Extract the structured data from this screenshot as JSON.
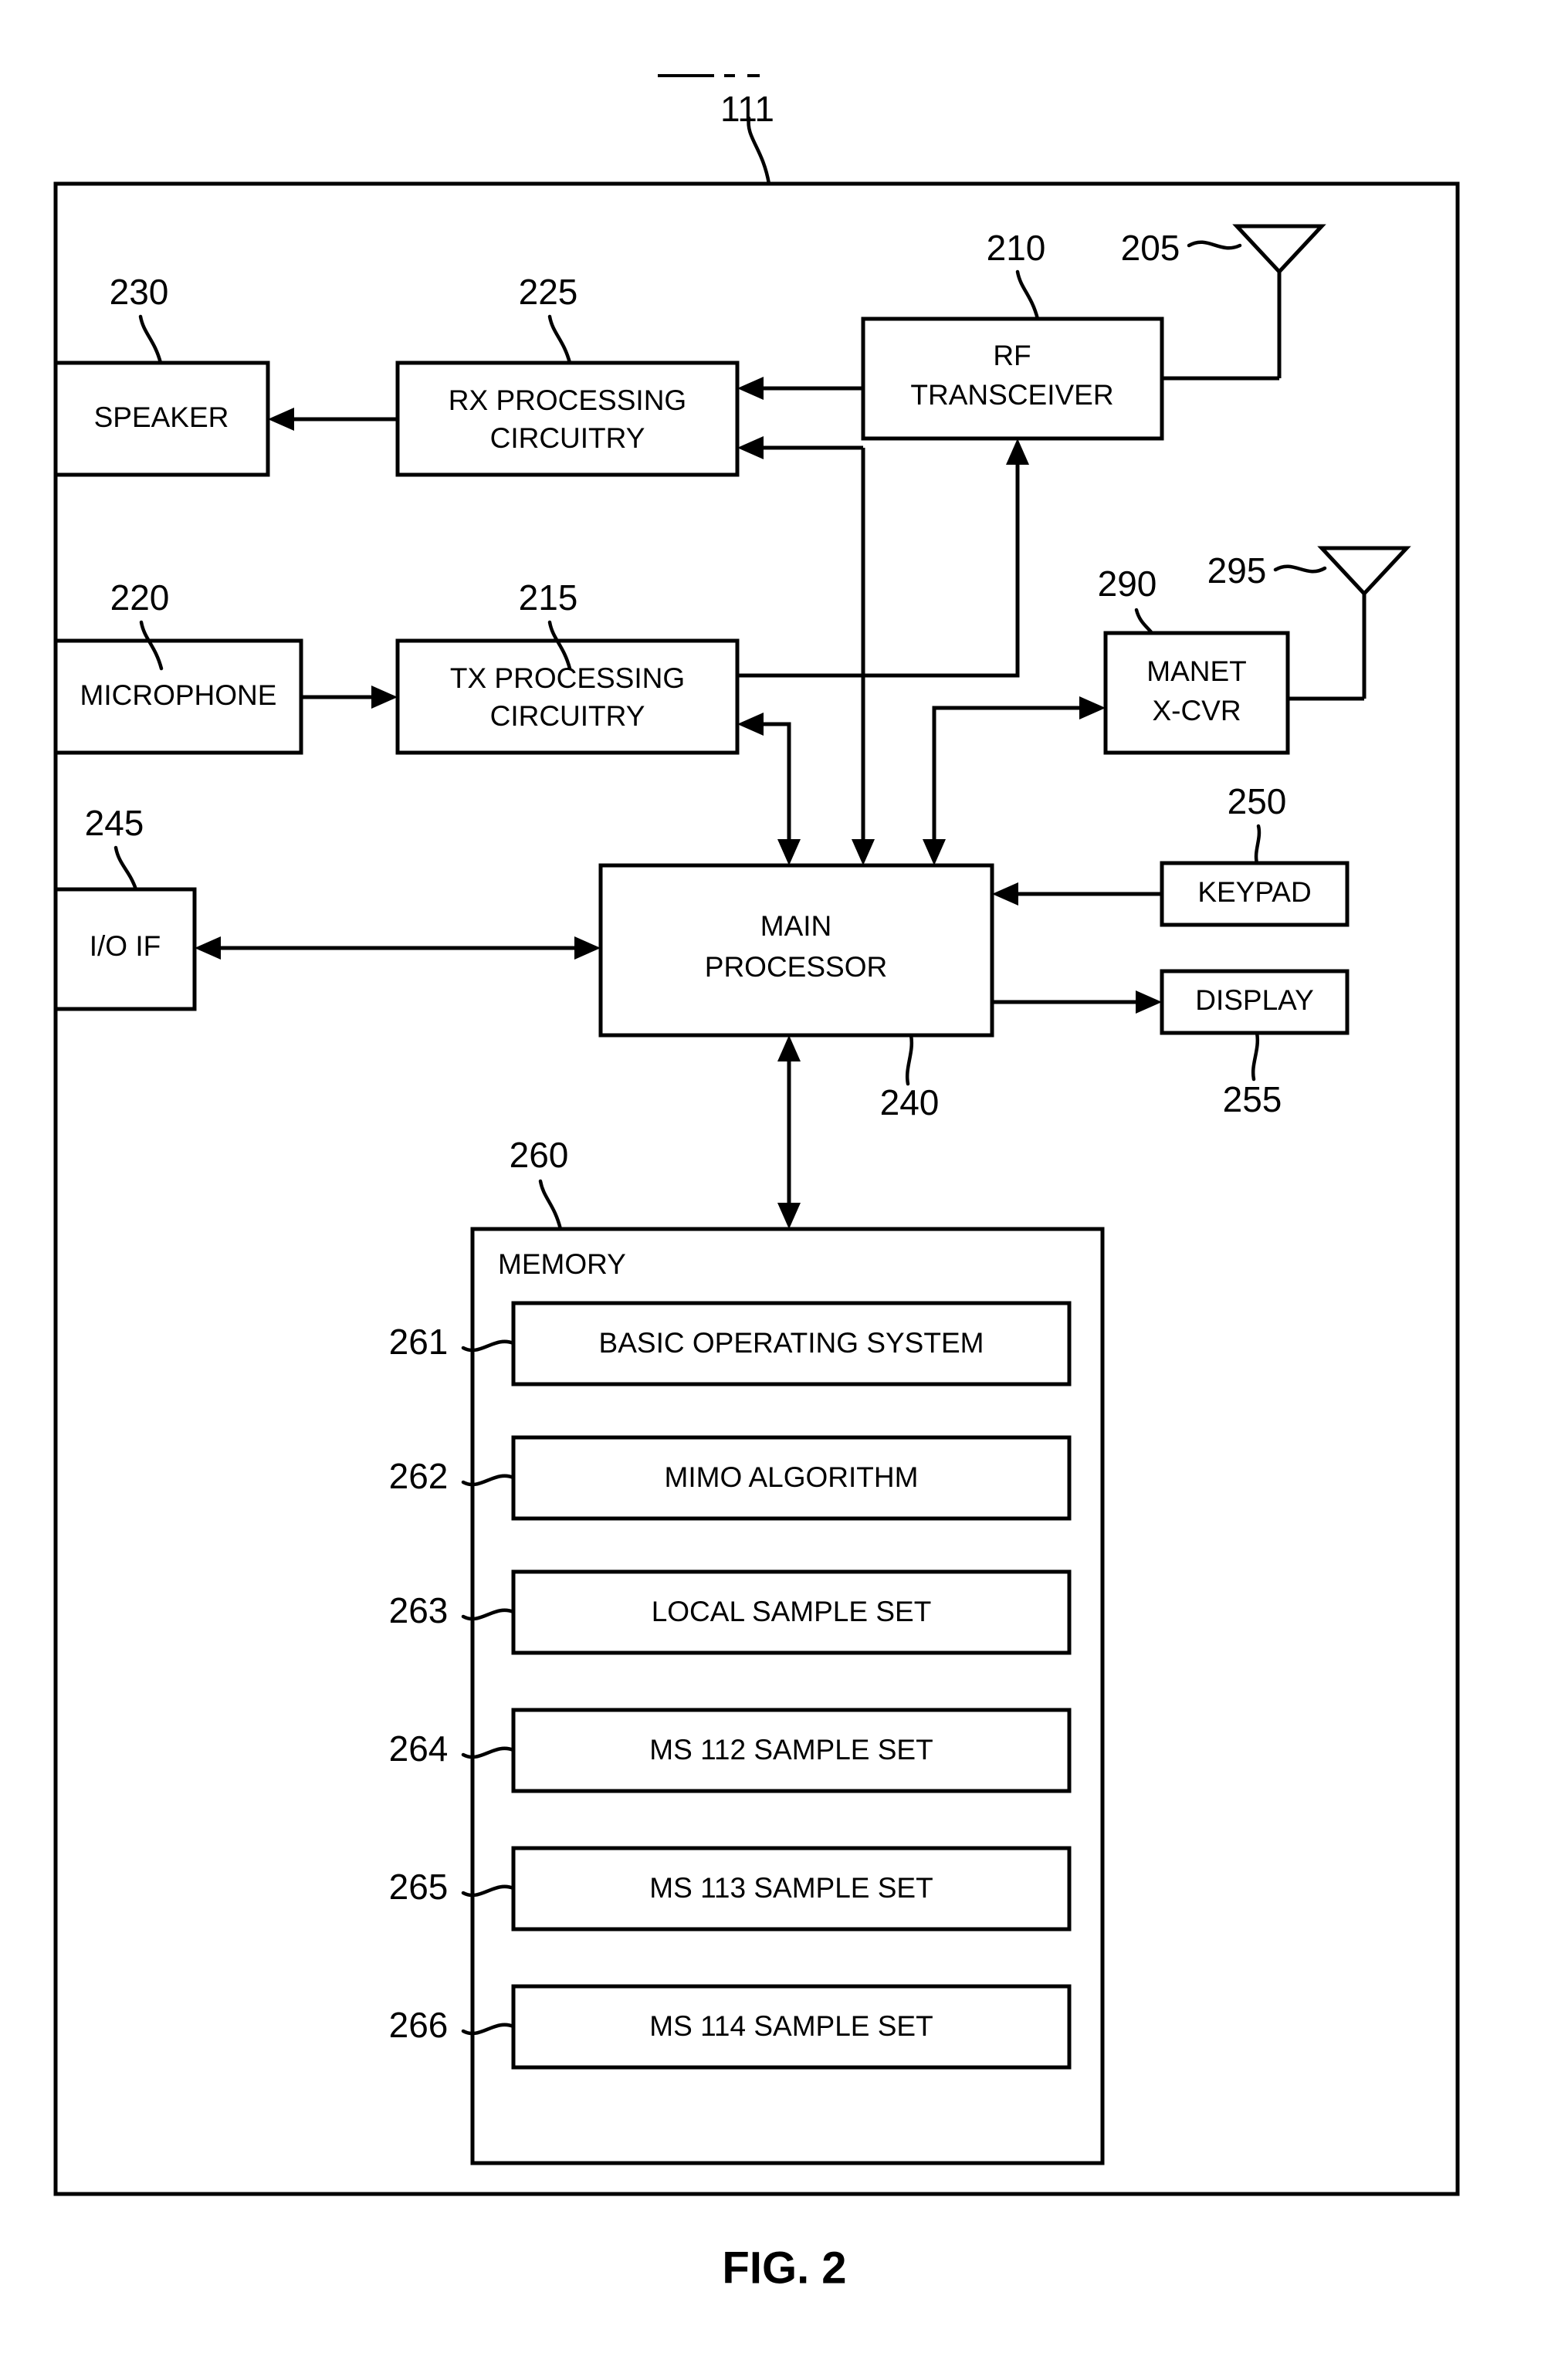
{
  "figure": {
    "caption": "FIG. 2",
    "device_ref": "111"
  },
  "blocks": [
    {
      "id": "speaker",
      "label": "SPEAKER",
      "ref": "230"
    },
    {
      "id": "rx_processing",
      "label_line1": "RX PROCESSING",
      "label_line2": "CIRCUITRY",
      "ref": "225"
    },
    {
      "id": "rf_transceiver",
      "label_line1": "RF",
      "label_line2": "TRANSCEIVER",
      "ref": "210"
    },
    {
      "id": "microphone",
      "label": "MICROPHONE",
      "ref": "220"
    },
    {
      "id": "tx_processing",
      "label_line1": "TX PROCESSING",
      "label_line2": "CIRCUITRY",
      "ref": "215"
    },
    {
      "id": "manet_xcvr",
      "label_line1": "MANET",
      "label_line2": "X-CVR",
      "ref": "290"
    },
    {
      "id": "io_if",
      "label": "I/O IF",
      "ref": "245"
    },
    {
      "id": "main_processor",
      "label_line1": "MAIN",
      "label_line2": "PROCESSOR",
      "ref": "240"
    },
    {
      "id": "keypad",
      "label": "KEYPAD",
      "ref": "250"
    },
    {
      "id": "display",
      "label": "DISPLAY",
      "ref": "255"
    }
  ],
  "antennas": [
    {
      "id": "main_antenna",
      "ref": "205"
    },
    {
      "id": "manet_antenna",
      "ref": "295"
    }
  ],
  "memory": {
    "title": "MEMORY",
    "ref": "260",
    "items": [
      {
        "ref": "261",
        "label": "BASIC OPERATING SYSTEM"
      },
      {
        "ref": "262",
        "label": "MIMO ALGORITHM"
      },
      {
        "ref": "263",
        "label": "LOCAL SAMPLE SET"
      },
      {
        "ref": "264",
        "label": "MS 112 SAMPLE SET"
      },
      {
        "ref": "265",
        "label": "MS 113 SAMPLE SET"
      },
      {
        "ref": "266",
        "label": "MS 114 SAMPLE SET"
      }
    ]
  },
  "colors": {
    "line": "#000000",
    "background": "#ffffff"
  }
}
